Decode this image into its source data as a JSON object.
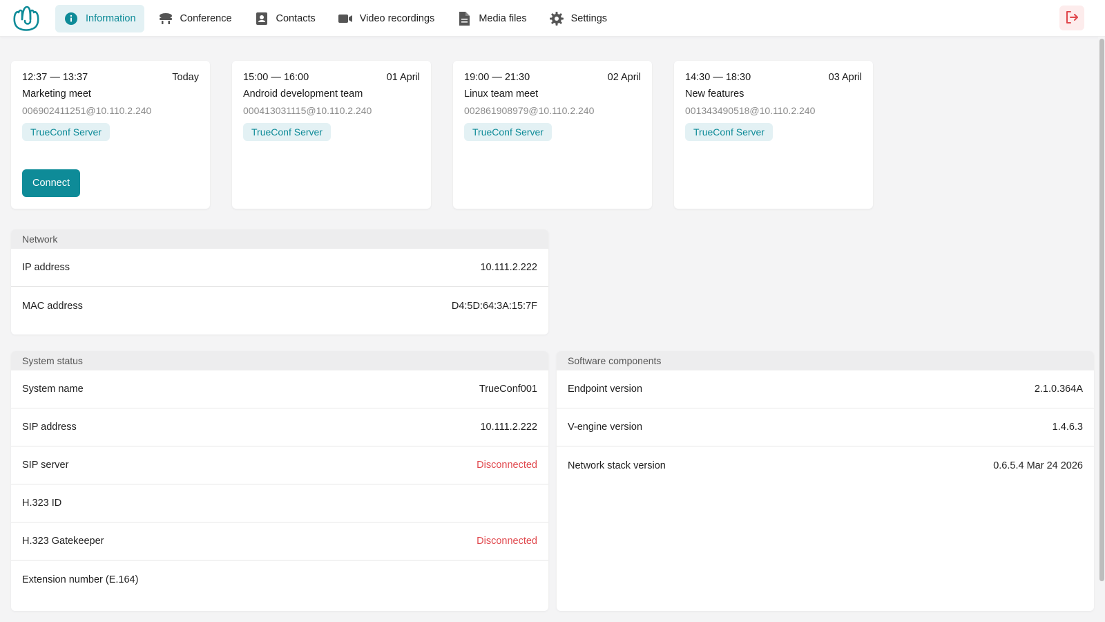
{
  "nav": {
    "items": [
      {
        "label": "Information",
        "icon": "info-icon",
        "active": true
      },
      {
        "label": "Conference",
        "icon": "conference-icon",
        "active": false
      },
      {
        "label": "Contacts",
        "icon": "contacts-icon",
        "active": false
      },
      {
        "label": "Video recordings",
        "icon": "video-icon",
        "active": false
      },
      {
        "label": "Media files",
        "icon": "file-icon",
        "active": false
      },
      {
        "label": "Settings",
        "icon": "gear-icon",
        "active": false
      }
    ],
    "logout_icon": "logout-icon"
  },
  "colors": {
    "accent": "#0e8b98",
    "accent_bg": "#e3f1f4",
    "danger": "#e0474c"
  },
  "meetings": [
    {
      "time": "12:37 — 13:37",
      "date": "Today",
      "title": "Marketing meet",
      "address": "006902411251@10.110.2.240",
      "server": "TrueConf Server",
      "connect_label": "Connect"
    },
    {
      "time": "15:00 — 16:00",
      "date": "01 April",
      "title": "Android development team",
      "address": "000413031115@10.110.2.240",
      "server": "TrueConf Server"
    },
    {
      "time": "19:00 — 21:30",
      "date": "02 April",
      "title": "Linux team meet",
      "address": "002861908979@10.110.2.240",
      "server": "TrueConf Server"
    },
    {
      "time": "14:30 — 18:30",
      "date": "03 April",
      "title": "New features",
      "address": "001343490518@10.110.2.240",
      "server": "TrueConf Server"
    }
  ],
  "network": {
    "title": "Network",
    "rows": [
      {
        "label": "IP address",
        "value": "10.111.2.222"
      },
      {
        "label": "MAC address",
        "value": "D4:5D:64:3A:15:7F"
      }
    ]
  },
  "system_status": {
    "title": "System status",
    "rows": [
      {
        "label": "System name",
        "value": "TrueConf001"
      },
      {
        "label": "SIP address",
        "value": "10.111.2.222"
      },
      {
        "label": "SIP server",
        "value": "Disconnected"
      },
      {
        "label": "H.323 ID",
        "value": ""
      },
      {
        "label": "H.323 Gatekeeper",
        "value": "Disconnected"
      },
      {
        "label": "Extension number (E.164)",
        "value": ""
      }
    ]
  },
  "software": {
    "title": "Software components",
    "rows": [
      {
        "label": "Endpoint version",
        "value": "2.1.0.364A"
      },
      {
        "label": "V-engine version",
        "value": "1.4.6.3"
      },
      {
        "label": "Network stack version",
        "value": "0.6.5.4 Mar 24 2026"
      }
    ]
  }
}
